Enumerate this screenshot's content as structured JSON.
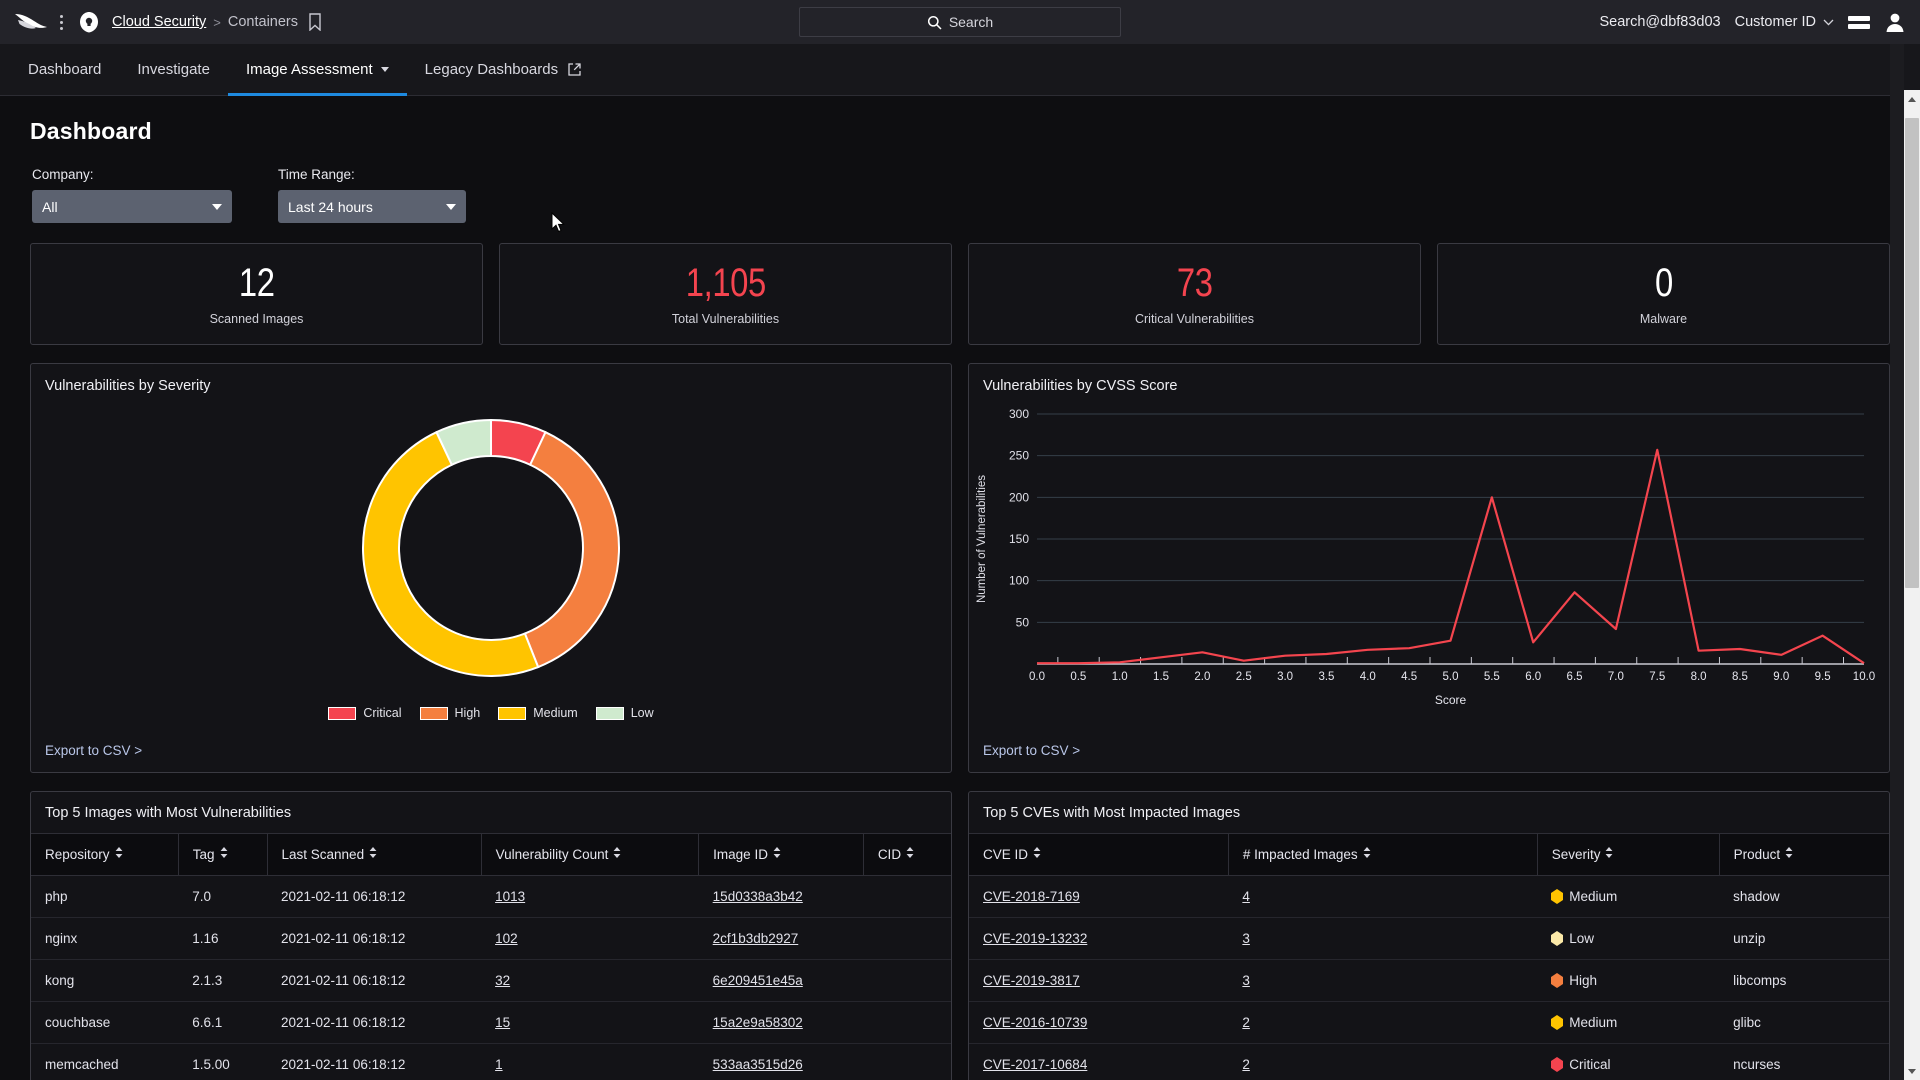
{
  "topbar": {
    "breadcrumb_link": "Cloud Security",
    "breadcrumb_separator": ">",
    "breadcrumb_current": "Containers",
    "search_placeholder": "Search",
    "account": "Search@dbf83d03",
    "customer_id_label": "Customer ID"
  },
  "nav": {
    "tabs": [
      {
        "label": "Dashboard",
        "active": false
      },
      {
        "label": "Investigate",
        "active": false
      },
      {
        "label": "Image Assessment",
        "active": true,
        "has_caret": true
      },
      {
        "label": "Legacy Dashboards",
        "active": false,
        "has_external": true
      }
    ]
  },
  "page": {
    "title": "Dashboard"
  },
  "filters": {
    "company": {
      "label": "Company:",
      "value": "All"
    },
    "time_range": {
      "label": "Time Range:",
      "value": "Last 24 hours"
    }
  },
  "stats": [
    {
      "value": "12",
      "caption": "Scanned Images",
      "color": "#ffffff"
    },
    {
      "value": "1,105",
      "caption": "Total Vulnerabilities",
      "color": "#f4444f"
    },
    {
      "value": "73",
      "caption": "Critical Vulnerabilities",
      "color": "#f4444f"
    },
    {
      "value": "0",
      "caption": "Malware",
      "color": "#ffffff"
    }
  ],
  "severity_panel": {
    "title": "Vulnerabilities by Severity",
    "export_label": "Export to CSV >"
  },
  "cvss_panel": {
    "title": "Vulnerabilities by CVSS Score",
    "export_label": "Export to CSV >"
  },
  "chart_data": [
    {
      "type": "pie",
      "title": "Vulnerabilities by Severity",
      "subtitle": "",
      "xlabel": "",
      "ylabel": "",
      "legend_position": "bottom",
      "categories": [
        "Critical",
        "High",
        "Medium",
        "Low"
      ],
      "values": [
        7,
        37,
        49,
        7
      ],
      "colors": [
        "#f4444f",
        "#f47f3f",
        "#ffc400",
        "#cfeace"
      ],
      "donut": true
    },
    {
      "type": "line",
      "title": "Vulnerabilities by CVSS Score",
      "xlabel": "Score",
      "ylabel": "Number of Vulnerabilities",
      "xlim": [
        0.0,
        10.0
      ],
      "ylim": [
        0,
        300
      ],
      "yticks": [
        0,
        50,
        100,
        150,
        200,
        250,
        300
      ],
      "grid": true,
      "legend_position": "none",
      "line_color": "#f4454e",
      "x": [
        0.0,
        0.5,
        1.0,
        1.5,
        2.0,
        2.5,
        3.0,
        3.5,
        4.0,
        4.5,
        5.0,
        5.5,
        6.0,
        6.5,
        7.0,
        7.5,
        8.0,
        8.5,
        9.0,
        9.5,
        10.0
      ],
      "xticklabels": [
        "0.0",
        "0.5",
        "1.0",
        "1.5",
        "2.0",
        "2.5",
        "3.0",
        "3.5",
        "4.0",
        "4.5",
        "5.0",
        "5.5",
        "6.0",
        "6.5",
        "7.0",
        "7.5",
        "8.0",
        "8.5",
        "9.0",
        "9.5",
        "10.0"
      ],
      "values": [
        1,
        1,
        2,
        8,
        14,
        4,
        10,
        12,
        17,
        19,
        28,
        200,
        26,
        86,
        42,
        257,
        16,
        18,
        11,
        34,
        1
      ]
    }
  ],
  "images_table": {
    "title": "Top 5 Images with Most Vulnerabilities",
    "columns": [
      "Repository",
      "Tag",
      "Last Scanned",
      "Vulnerability Count",
      "Image ID",
      "CID"
    ],
    "rows": [
      {
        "repository": "php",
        "tag": "7.0",
        "last_scanned": "2021-02-11 06:18:12",
        "vulnerability_count": "1013",
        "image_id": "15d0338a3b42",
        "cid": ""
      },
      {
        "repository": "nginx",
        "tag": "1.16",
        "last_scanned": "2021-02-11 06:18:12",
        "vulnerability_count": "102",
        "image_id": "2cf1b3db2927",
        "cid": ""
      },
      {
        "repository": "kong",
        "tag": "2.1.3",
        "last_scanned": "2021-02-11 06:18:12",
        "vulnerability_count": "32",
        "image_id": "6e209451e45a",
        "cid": ""
      },
      {
        "repository": "couchbase",
        "tag": "6.6.1",
        "last_scanned": "2021-02-11 06:18:12",
        "vulnerability_count": "15",
        "image_id": "15a2e9a58302",
        "cid": ""
      },
      {
        "repository": "memcached",
        "tag": "1.5.00",
        "last_scanned": "2021-02-11 06:18:12",
        "vulnerability_count": "1",
        "image_id": "533aa3515d26",
        "cid": ""
      }
    ]
  },
  "cves_table": {
    "title": "Top 5 CVEs with Most Impacted Images",
    "columns": [
      "CVE ID",
      "# Impacted Images",
      "Severity",
      "Product"
    ],
    "rows": [
      {
        "cve_id": "CVE-2018-7169",
        "impacted_images": "4",
        "severity": "Medium",
        "severity_color": "#ffc400",
        "product": "shadow"
      },
      {
        "cve_id": "CVE-2019-13232",
        "impacted_images": "3",
        "severity": "Low",
        "severity_color": "#fbe9a8",
        "product": "unzip"
      },
      {
        "cve_id": "CVE-2019-3817",
        "impacted_images": "3",
        "severity": "High",
        "severity_color": "#f47f3f",
        "product": "libcomps"
      },
      {
        "cve_id": "CVE-2016-10739",
        "impacted_images": "2",
        "severity": "Medium",
        "severity_color": "#ffc400",
        "product": "glibc"
      },
      {
        "cve_id": "CVE-2017-10684",
        "impacted_images": "2",
        "severity": "Critical",
        "severity_color": "#f4444f",
        "product": "ncurses"
      }
    ]
  },
  "colors": {
    "accent": "#1e8ae0",
    "critical": "#f4444f",
    "high": "#f47f3f",
    "medium": "#ffc400",
    "low": "#cfeace",
    "panel_bg": "#131317",
    "page_bg": "#0e0e11"
  }
}
